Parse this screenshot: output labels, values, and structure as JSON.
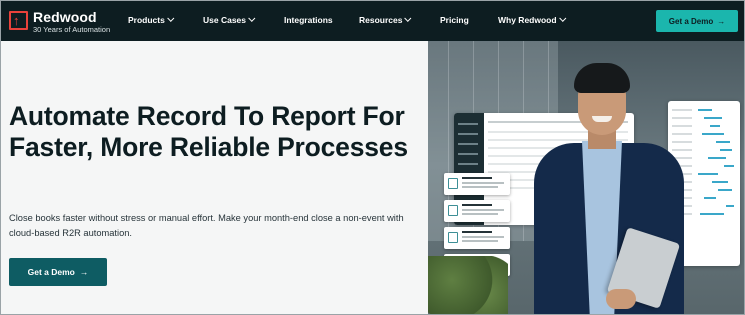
{
  "brand": {
    "name": "Redwood",
    "tagline": "30 Years of Automation",
    "accent": "#1bb6ad",
    "logo_color": "#e8423b"
  },
  "nav": {
    "items": [
      {
        "label": "Products",
        "has_dropdown": true
      },
      {
        "label": "Use Cases",
        "has_dropdown": true
      },
      {
        "label": "Integrations",
        "has_dropdown": false
      },
      {
        "label": "Resources",
        "has_dropdown": true
      },
      {
        "label": "Pricing",
        "has_dropdown": false
      },
      {
        "label": "Why Redwood",
        "has_dropdown": true
      }
    ],
    "cta_label": "Get a Demo"
  },
  "hero": {
    "title": "Automate Record To Report For Faster, More Reliable Processes",
    "subtitle": "Close books faster without stress or manual effort. Make your month-end close a non-event with cloud-based R2R automation.",
    "cta_label": "Get a Demo"
  },
  "icons": {
    "logo": "redwood-arrow-logo-icon",
    "dropdown": "chevron-down-icon",
    "cta_arrow": "arrow-right-icon"
  }
}
